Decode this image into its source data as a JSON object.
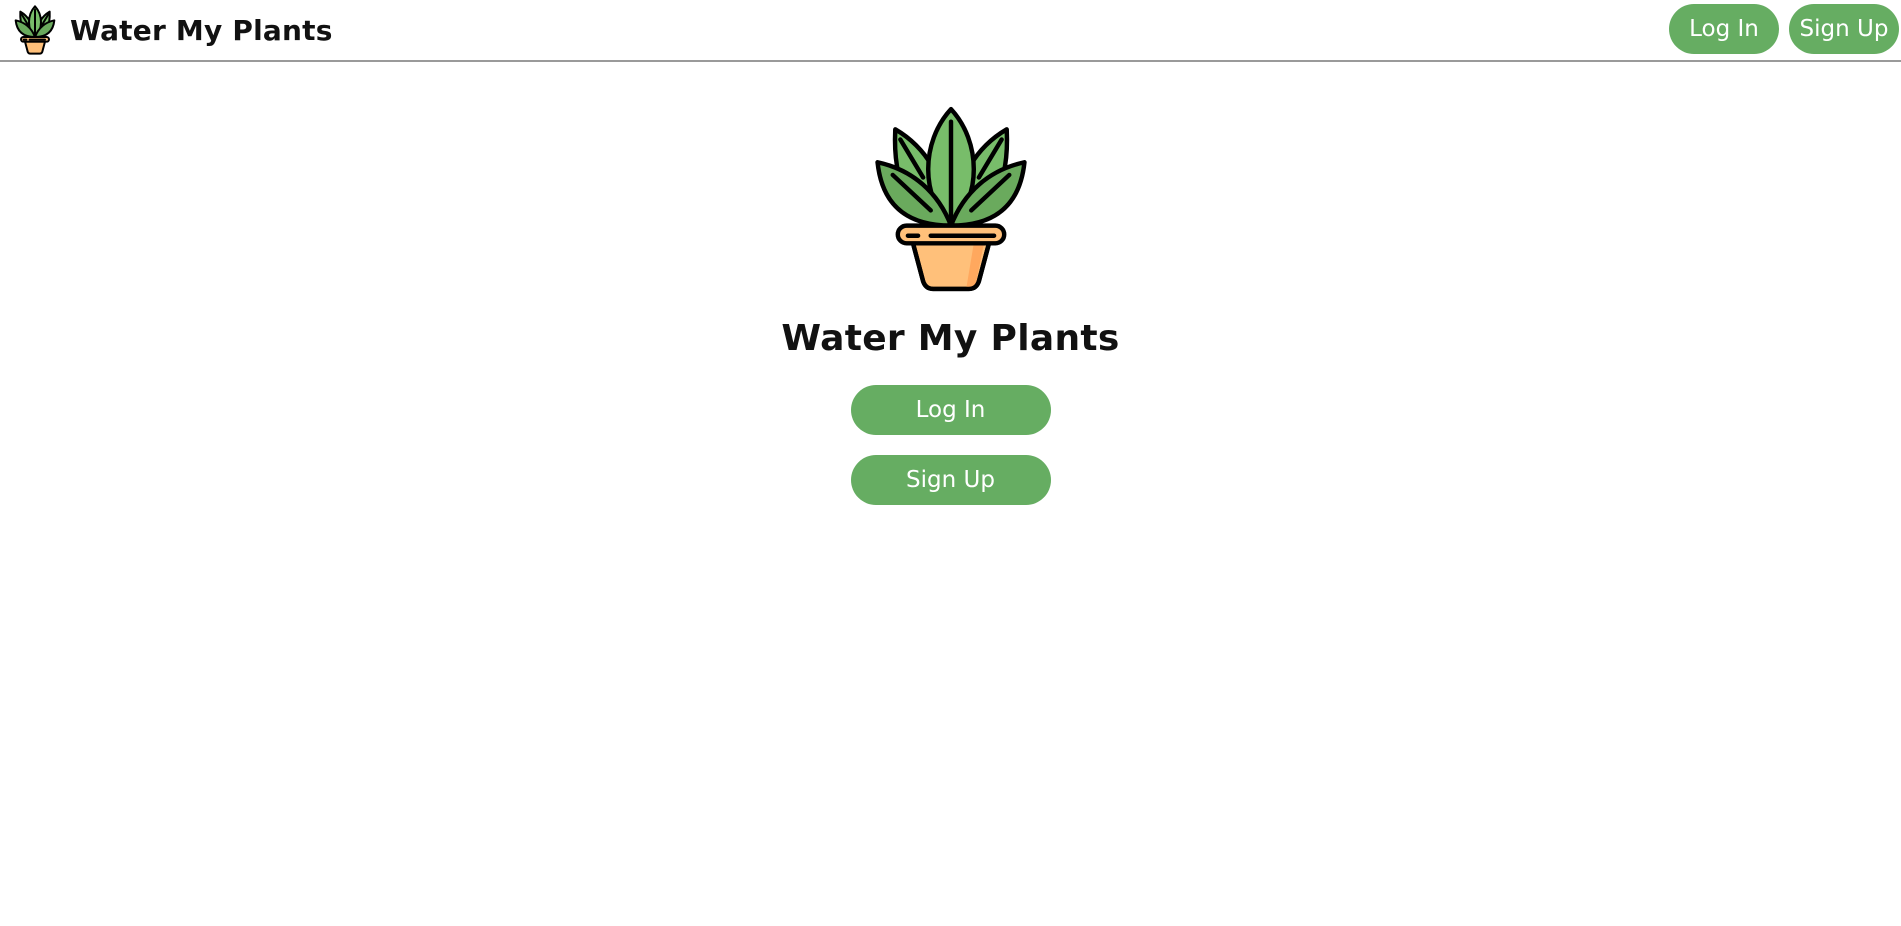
{
  "navbar": {
    "brand_title": "Water My Plants",
    "login_label": "Log In",
    "signup_label": "Sign Up"
  },
  "hero": {
    "title": "Water My Plants",
    "login_label": "Log In",
    "signup_label": "Sign Up"
  },
  "icons": {
    "logo": "potted-plant-icon"
  },
  "colors": {
    "button_green": "#66ad62",
    "leaf_green": "#78bd6a",
    "pot_orange": "#ffc07a",
    "outline": "#000000",
    "divider": "#9a9a9a"
  }
}
